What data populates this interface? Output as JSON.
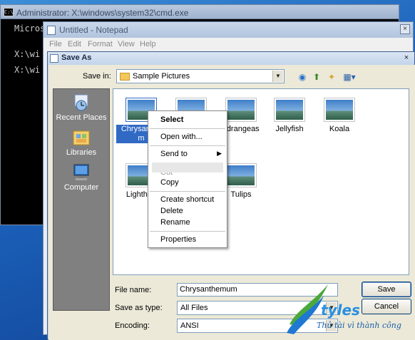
{
  "cmd": {
    "title": "Administrator: X:\\windows\\system32\\cmd.exe",
    "icon_label": "C:\\",
    "lines": [
      "Micros",
      "X:\\wi",
      "X:\\wi"
    ]
  },
  "notepad": {
    "title": "Untitled - Notepad",
    "menu": [
      "File",
      "Edit",
      "Format",
      "View",
      "Help"
    ]
  },
  "dialog": {
    "title": "Save As",
    "save_in_label": "Save in:",
    "save_in_value": "Sample Pictures",
    "places": [
      {
        "label": "Recent Places",
        "icon": "recent-places-icon"
      },
      {
        "label": "Libraries",
        "icon": "libraries-icon"
      },
      {
        "label": "Computer",
        "icon": "computer-icon"
      }
    ],
    "files": [
      {
        "label_line1": "Chrysanthe",
        "label_line2": "m"
      },
      {
        "label_line1": "ydrangeas",
        "label_line2": ""
      },
      {
        "label_line1": "Jellyfish",
        "label_line2": ""
      },
      {
        "label_line1": "Koala",
        "label_line2": ""
      },
      {
        "label_line1": "Lighthou",
        "label_line2": ""
      },
      {
        "label_line1": "Tulips",
        "label_line2": ""
      }
    ],
    "context_menu": {
      "items": [
        "Select",
        "Open with...",
        "Send to",
        "Copy",
        "Create shortcut",
        "Delete",
        "Rename",
        "Properties"
      ],
      "obscured_fragment": "Cut"
    },
    "file_name_label": "File name:",
    "file_name_value": "Chrysanthemum",
    "save_type_label": "Save as type:",
    "save_type_value": "All Files",
    "encoding_label": "Encoding:",
    "encoding_value": "ANSI",
    "save_button": "Save",
    "cancel_button": "Cancel"
  },
  "watermark": {
    "brand": "tyles",
    "tagline": "Thủ tài vì thành công"
  },
  "colors": {
    "desktop": "#1d62b5",
    "selection": "#316ac5",
    "dialog_bg": "#ece9d8",
    "places_bar": "#808080"
  }
}
